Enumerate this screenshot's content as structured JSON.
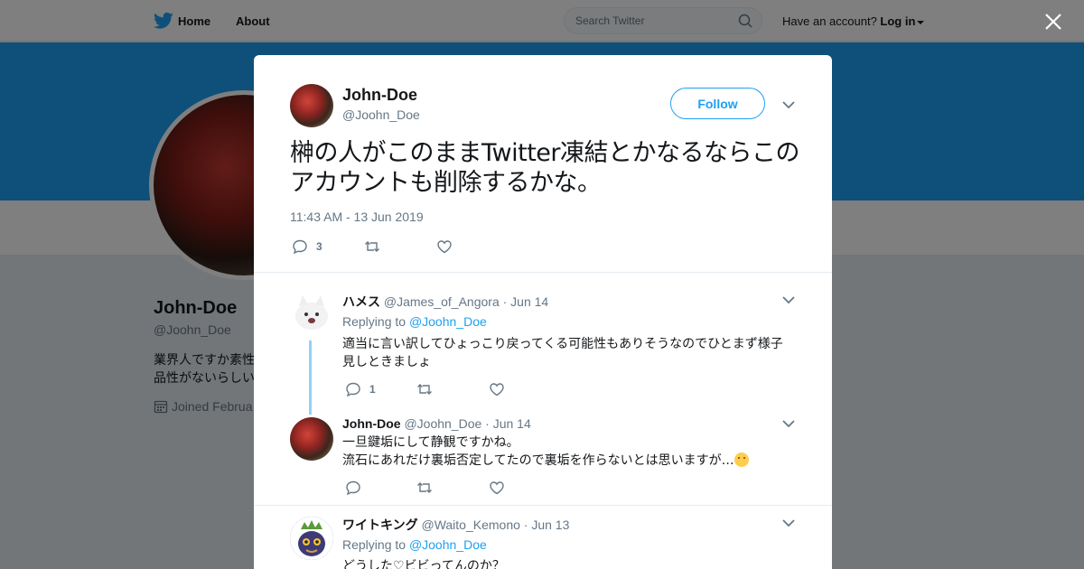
{
  "topbar": {
    "home_label": "Home",
    "about_label": "About",
    "search_placeholder": "Search Twitter",
    "account_question": "Have an account?",
    "login_label": "Log in"
  },
  "profile": {
    "name": "John-Doe",
    "handle": "@Joohn_Doe",
    "bio": "業界人ですか素性… 品性がないらしい…",
    "joined": "Joined Februa"
  },
  "tweet": {
    "author_name": "John-Doe",
    "author_handle": "@Joohn_Doe",
    "follow_label": "Follow",
    "text": "榊の人がこのままTwitter凍結とかなるならこのアカウントも削除するかな。",
    "timestamp": "11:43 AM - 13 Jun 2019",
    "reply_count": "3"
  },
  "replies": [
    {
      "name": "ハメス",
      "handle": "@James_of_Angora",
      "date": "· Jun 14",
      "replying_prefix": "Replying to",
      "replying_to": "@Joohn_Doe",
      "text": "適当に言い訳してひょっこり戻ってくる可能性もありそうなのでひとまず様子見しときましょ",
      "reply_count": "1"
    },
    {
      "name": "John-Doe",
      "handle": "@Joohn_Doe",
      "date": "· Jun 14",
      "text_line1": "一旦鍵垢にして静観ですかね。",
      "text_line2": "流石にあれだけ裏垢否定してたので裏垢を作らないとは思いますが…"
    },
    {
      "name": "ワイトキング",
      "handle": "@Waito_Kemono",
      "date": "· Jun 13",
      "replying_prefix": "Replying to",
      "replying_to": "@Joohn_Doe",
      "text": "どうした♡ビビってんのか？"
    }
  ],
  "colors": {
    "accent": "#1da1f2",
    "banner": "#1da1f2",
    "muted": "#657786"
  }
}
